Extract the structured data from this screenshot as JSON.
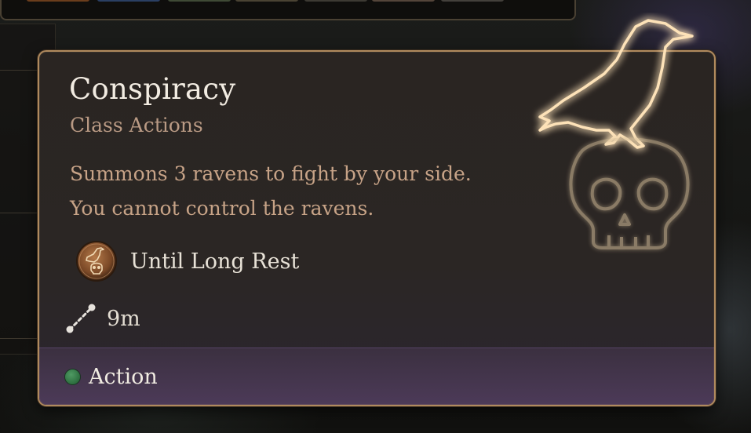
{
  "tooltip": {
    "title": "Conspiracy",
    "category": "Class Actions",
    "description_lines": [
      "Summons 3 ravens to fight by your side.",
      "You cannot control the ravens."
    ],
    "duration": {
      "icon": "raven-skull-icon",
      "label": "Until Long Rest"
    },
    "range": {
      "icon": "range-icon",
      "value": "9m"
    },
    "cost": {
      "type": "Action",
      "color": "#3a8a50"
    },
    "emblem_icon": "raven-on-skull-icon",
    "colors": {
      "border": "#b08a5e",
      "title": "#f2ece2",
      "subtitle": "#b99a84",
      "description": "#c7a387",
      "footer": "#4c3a58",
      "glow": "#f6b668"
    }
  }
}
